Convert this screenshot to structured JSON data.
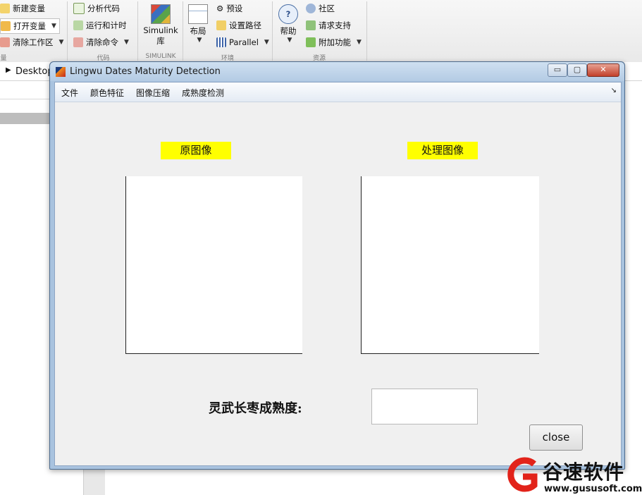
{
  "toolstrip": {
    "variable_items": [
      "新建变量",
      "打开变量",
      "清除工作区"
    ],
    "code_items": [
      "分析代码",
      "运行和计时",
      "清除命令"
    ],
    "simulink_label": "Simulink\n库",
    "simulink_line1": "Simulink",
    "simulink_line2": "库",
    "layout_label": "布局",
    "env_items": [
      "预设",
      "设置路径",
      "Parallel"
    ],
    "help_label": "帮助",
    "resource_items": [
      "社区",
      "请求支持",
      "附加功能"
    ],
    "section_labels": [
      "量",
      "代码",
      "SIMULINK",
      "环境",
      "资源"
    ]
  },
  "pathbar": {
    "folder": "Desktop"
  },
  "window": {
    "title": "Lingwu Dates Maturity Detection",
    "controls": {
      "minimize": "▭",
      "maximize": "▢",
      "close": "✕"
    }
  },
  "menubar": {
    "items": [
      "文件",
      "颜色特征",
      "图像压缩",
      "成熟度检测"
    ],
    "overflow": "↘"
  },
  "panels": {
    "original_label": "原图像",
    "processed_label": "处理图像"
  },
  "result": {
    "label": "灵武长枣成熟度:",
    "value": ""
  },
  "close_button": {
    "label": "close"
  },
  "watermark": {
    "name": "谷速软件",
    "url": "www.gususoft.com"
  },
  "colors": {
    "label_highlight": "#ffff00",
    "window_frame": "#a9c3df",
    "client_bg": "#f0f0f0"
  }
}
